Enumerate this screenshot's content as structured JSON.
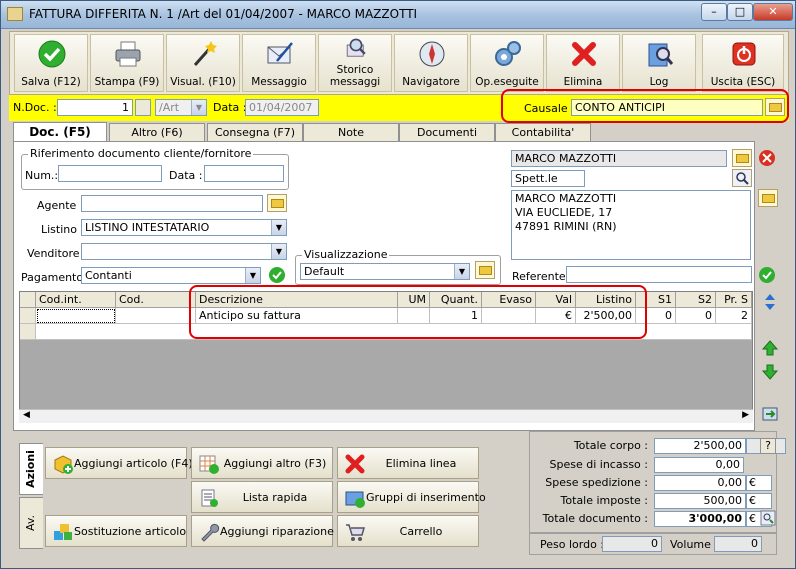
{
  "window": {
    "title": "FATTURA DIFFERITA N. 1 /Art del 01/04/2007 - MARCO MAZZOTTI"
  },
  "toolbar": [
    {
      "label": "Salva (F12)",
      "icon": "check-icon"
    },
    {
      "label": "Stampa (F9)",
      "icon": "printer-icon"
    },
    {
      "label": "Visual. (F10)",
      "icon": "magic-wand-icon"
    },
    {
      "label": "Messaggio",
      "icon": "envelope-icon"
    },
    {
      "label": "Storico messaggi",
      "icon": "search-mail-icon"
    },
    {
      "label": "Navigatore",
      "icon": "compass-icon"
    },
    {
      "label": "Op.eseguite",
      "icon": "gears-icon"
    },
    {
      "label": "Elimina",
      "icon": "delete-icon"
    },
    {
      "label": "Log",
      "icon": "log-icon"
    },
    {
      "label": "Uscita (ESC)",
      "icon": "power-icon"
    }
  ],
  "docbar": {
    "ndoc_label": "N.Doc. :",
    "ndoc_value": "1",
    "series_value": "/Art",
    "data_label": "Data :",
    "data_value": "01/04/2007",
    "causale_label": "Causale :",
    "causale_value": "CONTO ANTICIPI"
  },
  "tabs": [
    "Doc. (F5)",
    "Altro (F6)",
    "Consegna (F7)",
    "Note",
    "Documenti",
    "Contabilita'"
  ],
  "form": {
    "rif_legend": "Riferimento documento cliente/fornitore",
    "num_label": "Num.:",
    "num_value": "",
    "data_label": "Data :",
    "data_value": "",
    "agente_label": "Agente :",
    "agente_value": "",
    "listino_label": "Listino :",
    "listino_value": "LISTINO INTESTATARIO",
    "venditore_label": "Venditore :",
    "venditore_value": "",
    "pagamento_label": "Pagamento :",
    "pagamento_value": "Contanti",
    "visual_legend": "Visualizzazione",
    "visual_value": "Default"
  },
  "customer": {
    "name": "MARCO MAZZOTTI",
    "salutation": "Spett.le",
    "address_lines": [
      "MARCO MAZZOTTI",
      "VIA EUCLIEDE, 17",
      "47891 RIMINI (RN)"
    ],
    "referente_label": "Referente",
    "referente_value": ""
  },
  "grid": {
    "columns": [
      "Cod.int.",
      "Cod.",
      "Descrizione",
      "UM",
      "Quant.",
      "Evaso",
      "Val",
      "Listino",
      "S1",
      "S2",
      "Pr. S"
    ],
    "rows": [
      [
        "",
        "",
        "Anticipo su fattura",
        "",
        "1",
        "",
        "€",
        "2'500,00",
        "0",
        "0",
        "2"
      ]
    ]
  },
  "actions": {
    "tab_azioni": "Azioni",
    "tab_av": "Av.",
    "buttons": [
      {
        "label": "Aggiungi articolo (F4)",
        "icon": "add-article-icon"
      },
      {
        "label": "Aggiungi altro (F3)",
        "icon": "add-other-icon"
      },
      {
        "label": "Elimina linea",
        "icon": "delete-line-icon"
      },
      {
        "label": "Lista rapida",
        "icon": "quick-list-icon"
      },
      {
        "label": "Gruppi di inserimento",
        "icon": "insert-groups-icon"
      },
      {
        "label": "Sostituzione articolo",
        "icon": "replace-article-icon"
      },
      {
        "label": "Aggiungi riparazione",
        "icon": "wrench-icon"
      },
      {
        "label": "Carrello",
        "icon": "cart-icon"
      }
    ]
  },
  "totals": {
    "totale_corpo_label": "Totale corpo :",
    "totale_corpo": "2'500,00",
    "help": "?",
    "spese_incasso_label": "Spese di incasso :",
    "spese_incasso": "0,00",
    "spese_spedizione_label": "Spese spedizione :",
    "spese_spedizione": "0,00",
    "totale_imposte_label": "Totale imposte :",
    "totale_imposte": "500,00",
    "totale_documento_label": "Totale documento :",
    "totale_documento": "3'000,00",
    "currency": "€"
  },
  "weights": {
    "peso_label": "Peso lordo :",
    "peso": "0",
    "volume_label": "Volume :",
    "volume": "0"
  },
  "colors": {
    "highlight_yellow": "#ffff00",
    "annotation_red": "#e00000"
  }
}
